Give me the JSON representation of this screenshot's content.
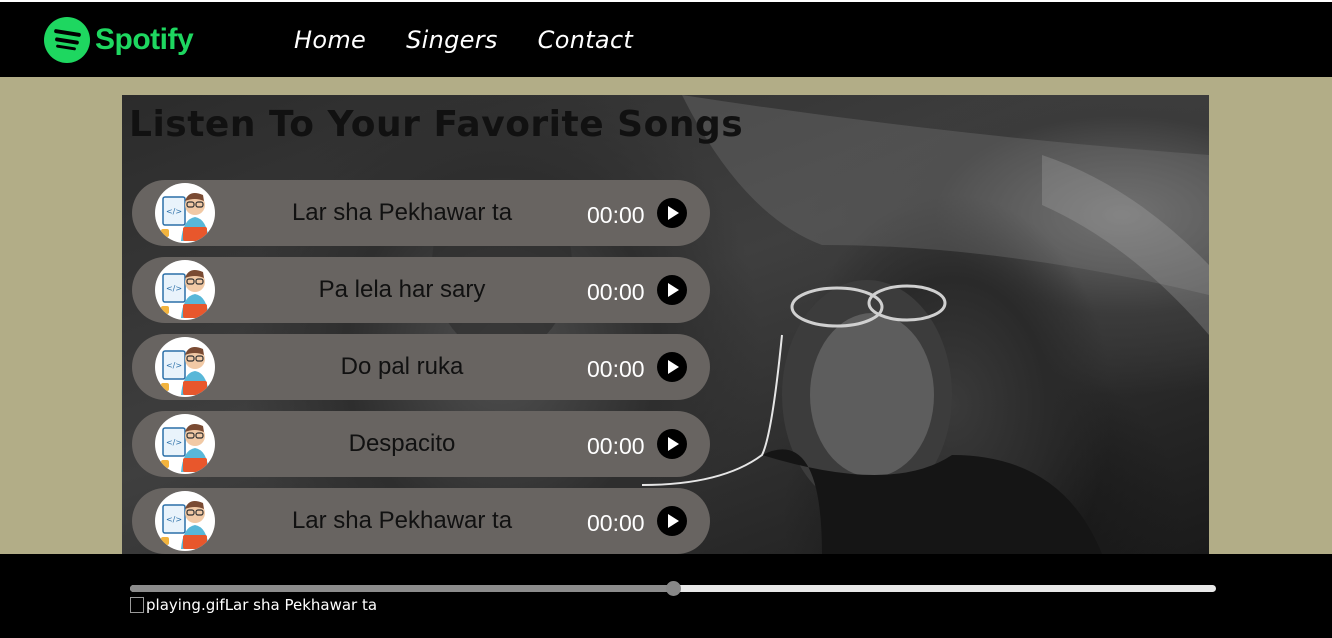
{
  "brand": {
    "name": "Spotify",
    "color": "#1ed760"
  },
  "nav": {
    "items": [
      {
        "label": "Home"
      },
      {
        "label": "Singers"
      },
      {
        "label": "Contact"
      }
    ]
  },
  "hero": {
    "title": "Listen To Your Favorite Songs"
  },
  "songs": [
    {
      "name": "Lar sha Pekhawar ta",
      "time": "00:00",
      "avatar": "developer-avatar-icon"
    },
    {
      "name": "Pa lela har sary",
      "time": "00:00",
      "avatar": "developer-avatar-icon"
    },
    {
      "name": "Do pal ruka",
      "time": "00:00",
      "avatar": "developer-avatar-icon"
    },
    {
      "name": "Despacito",
      "time": "00:00",
      "avatar": "developer-avatar-icon"
    },
    {
      "name": "Lar sha Pekhawar ta",
      "time": "00:00",
      "avatar": "developer-avatar-icon"
    }
  ],
  "player": {
    "progress_fraction": 0.5,
    "playing_gif_alt": "playing.gif",
    "current_song": "Lar sha Pekhawar ta"
  }
}
